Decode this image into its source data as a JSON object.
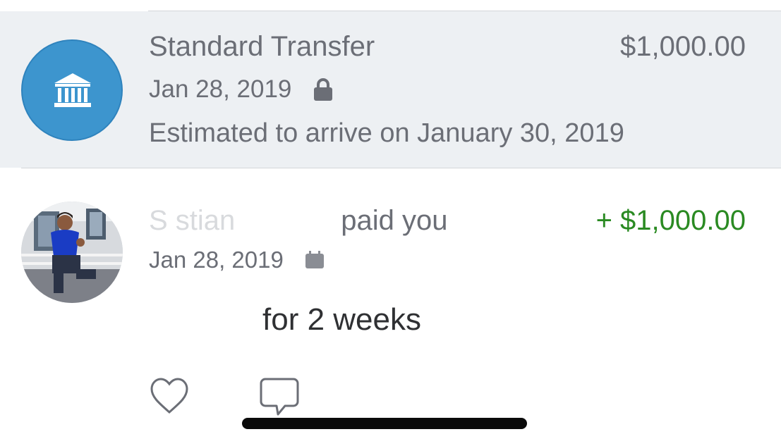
{
  "transfer": {
    "title": "Standard Transfer",
    "amount": "$1,000.00",
    "date": "Jan 28, 2019",
    "arrival": "Estimated to arrive on January 30, 2019",
    "icon": "bank-icon",
    "status_icon": "lock-icon",
    "colors": {
      "avatar_bg": "#3d95ce",
      "row_bg": "#edf0f3"
    }
  },
  "payment": {
    "payer_visible": "S   stian",
    "action": "paid you",
    "amount": "+ $1,000.00",
    "date": "Jan 28, 2019",
    "status_icon": "calendar-icon",
    "note": "for 2 weeks",
    "colors": {
      "amount": "#2a8a22"
    }
  },
  "actions": {
    "like_icon": "heart-icon",
    "comment_icon": "comment-icon"
  }
}
